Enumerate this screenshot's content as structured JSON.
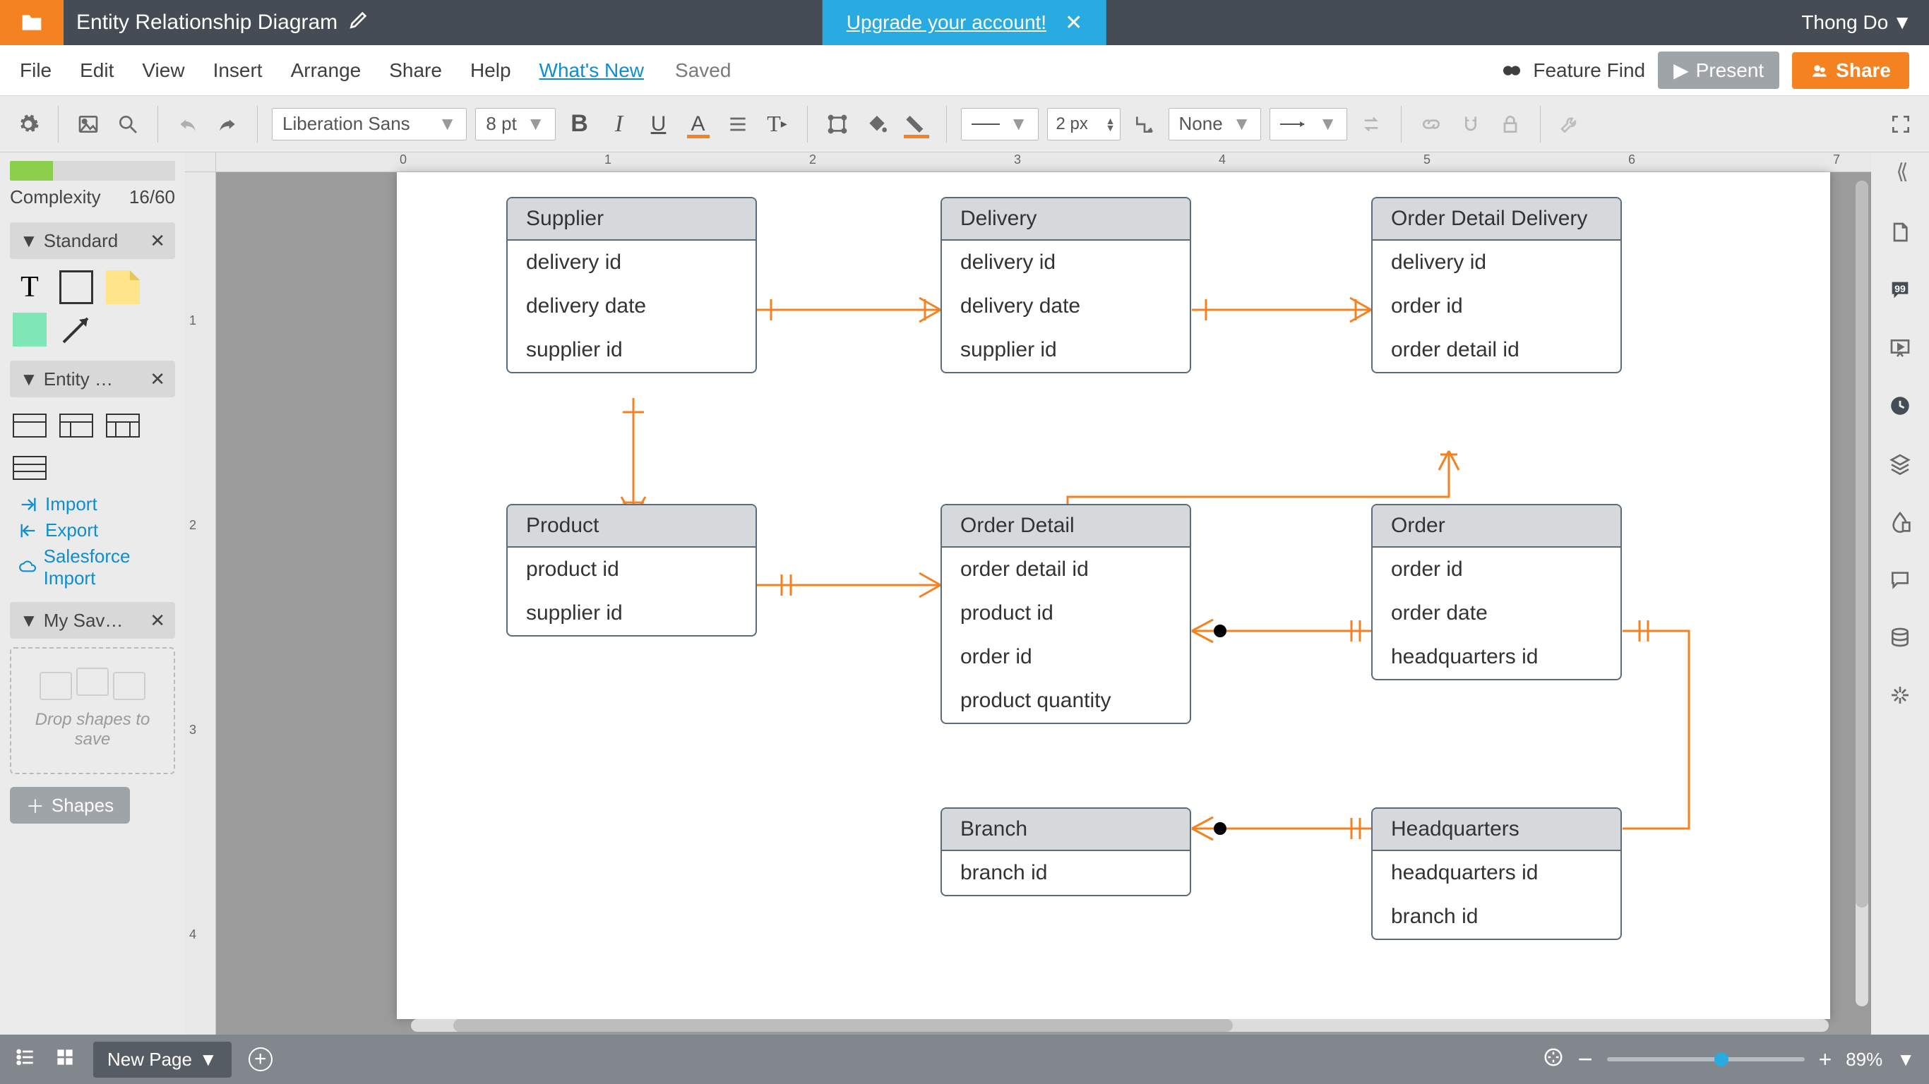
{
  "titlebar": {
    "doc_title": "Entity Relationship Diagram",
    "upgrade": "Upgrade your account!",
    "user": "Thong Do"
  },
  "menubar": {
    "items": [
      "File",
      "Edit",
      "View",
      "Insert",
      "Arrange",
      "Share",
      "Help"
    ],
    "whatsnew": "What's New",
    "saved": "Saved",
    "feature_find": "Feature Find",
    "present": "Present",
    "share": "Share"
  },
  "toolbar": {
    "font": "Liberation Sans",
    "font_size": "8 pt",
    "line_width": "2 px",
    "line_style": "None"
  },
  "leftpanel": {
    "complexity_label": "Complexity",
    "complexity_value": "16/60",
    "groups": {
      "standard": "Standard",
      "entity": "Entity …",
      "mysaved": "My Sav…"
    },
    "links": {
      "import": "Import",
      "export": "Export",
      "sf_import": "Salesforce Import"
    },
    "dropzone": "Drop shapes to save",
    "shapes_btn": "Shapes"
  },
  "statusbar": {
    "new_page": "New Page",
    "zoom": "89%"
  },
  "entities": {
    "supplier": {
      "title": "Supplier",
      "rows": [
        "delivery id",
        "delivery date",
        "supplier id"
      ]
    },
    "delivery": {
      "title": "Delivery",
      "rows": [
        "delivery id",
        "delivery date",
        "supplier id"
      ]
    },
    "odd": {
      "title": "Order Detail Delivery",
      "rows": [
        "delivery id",
        "order id",
        "order detail id"
      ]
    },
    "product": {
      "title": "Product",
      "rows": [
        "product id",
        "supplier id"
      ]
    },
    "orderdet": {
      "title": "Order Detail",
      "rows": [
        "order detail id",
        "product id",
        "order id",
        "product quantity"
      ]
    },
    "order": {
      "title": "Order",
      "rows": [
        "order id",
        "order date",
        "headquarters id"
      ]
    },
    "branch": {
      "title": "Branch",
      "rows": [
        "branch id"
      ]
    },
    "hq": {
      "title": "Headquarters",
      "rows": [
        "headquarters id",
        "branch id"
      ]
    }
  },
  "ruler_h": [
    "0",
    "1",
    "2",
    "3",
    "4",
    "5",
    "6",
    "7"
  ],
  "ruler_v": [
    "1",
    "2",
    "3",
    "4"
  ],
  "chart_data": {
    "type": "erd",
    "entities": [
      {
        "name": "Supplier",
        "attributes": [
          "delivery id",
          "delivery date",
          "supplier id"
        ]
      },
      {
        "name": "Delivery",
        "attributes": [
          "delivery id",
          "delivery date",
          "supplier id"
        ]
      },
      {
        "name": "Order Detail Delivery",
        "attributes": [
          "delivery id",
          "order id",
          "order detail id"
        ]
      },
      {
        "name": "Product",
        "attributes": [
          "product id",
          "supplier id"
        ]
      },
      {
        "name": "Order Detail",
        "attributes": [
          "order detail id",
          "product id",
          "order id",
          "product quantity"
        ]
      },
      {
        "name": "Order",
        "attributes": [
          "order id",
          "order date",
          "headquarters id"
        ]
      },
      {
        "name": "Branch",
        "attributes": [
          "branch id"
        ]
      },
      {
        "name": "Headquarters",
        "attributes": [
          "headquarters id",
          "branch id"
        ]
      }
    ],
    "relationships": [
      {
        "from": "Supplier",
        "to": "Delivery",
        "from_card": "one",
        "to_card": "many"
      },
      {
        "from": "Delivery",
        "to": "Order Detail Delivery",
        "from_card": "one",
        "to_card": "many"
      },
      {
        "from": "Supplier",
        "to": "Product",
        "from_card": "one",
        "to_card": "many"
      },
      {
        "from": "Product",
        "to": "Order Detail",
        "from_card": "one",
        "to_card": "many"
      },
      {
        "from": "Order Detail Delivery",
        "to": "Order Detail",
        "from_card": "many",
        "to_card": "one"
      },
      {
        "from": "Order Detail",
        "to": "Order",
        "from_card": "many",
        "to_card": "one-mandatory"
      },
      {
        "from": "Order",
        "to": "Headquarters",
        "from_card": "many",
        "to_card": "one-mandatory"
      },
      {
        "from": "Branch",
        "to": "Headquarters",
        "from_card": "many",
        "to_card": "one-mandatory"
      }
    ]
  }
}
